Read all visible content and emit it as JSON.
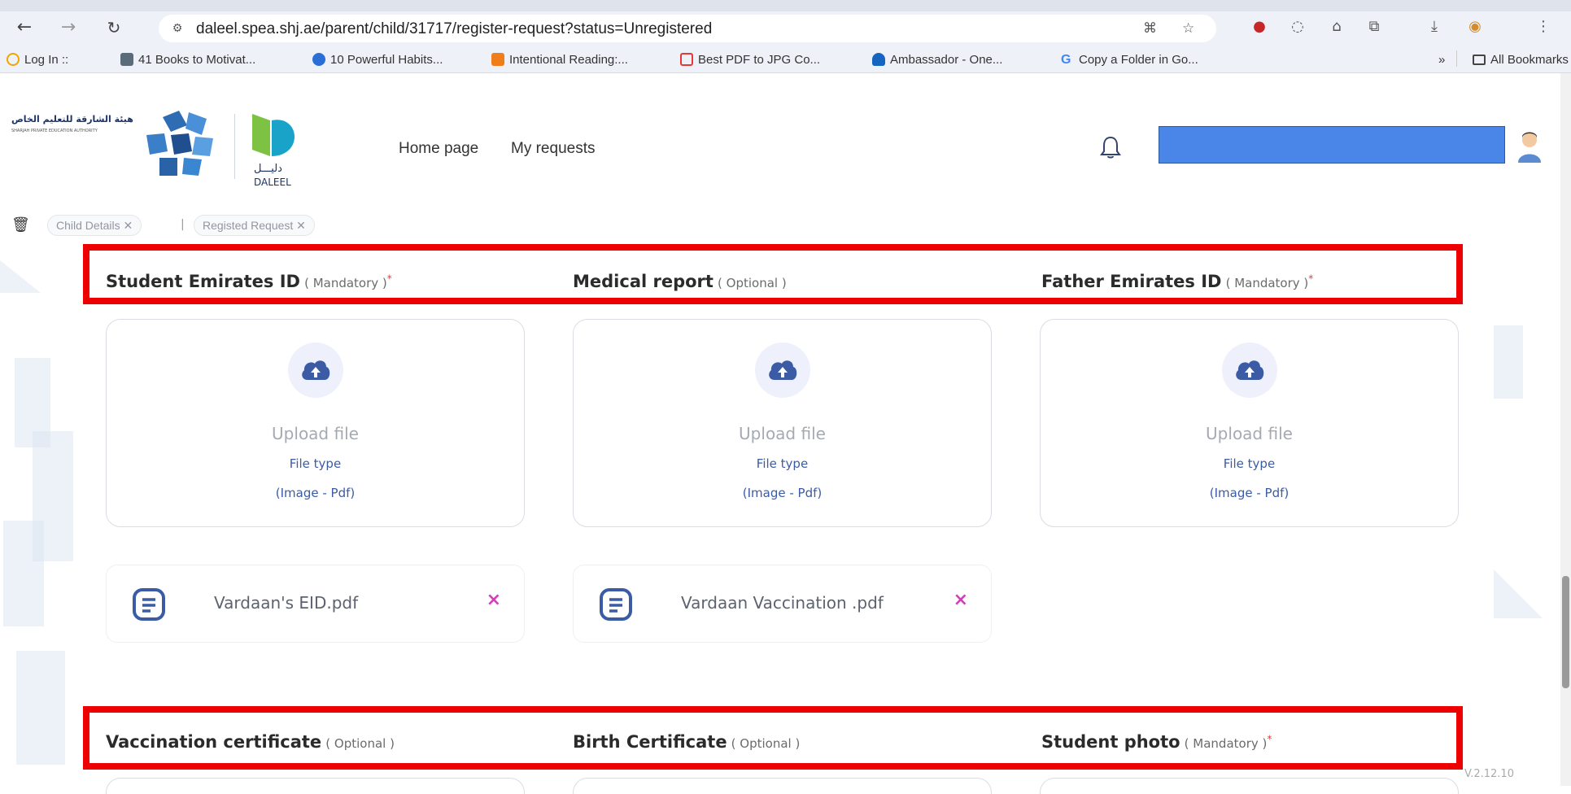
{
  "browser": {
    "url": "daleel.spea.shj.ae/parent/child/31717/register-request?status=Unregistered",
    "bookmarks": [
      {
        "label": "Log In ::"
      },
      {
        "label": "41 Books to Motivat..."
      },
      {
        "label": "10 Powerful Habits..."
      },
      {
        "label": "Intentional Reading:..."
      },
      {
        "label": "Best PDF to JPG Co..."
      },
      {
        "label": "Ambassador - One..."
      },
      {
        "label": "Copy a Folder in Go..."
      }
    ],
    "overflow_label": "»",
    "all_bookmarks_label": "All Bookmarks"
  },
  "header": {
    "logo_ar": "هيئة الشارقة للتعليم الخاص",
    "logo_en": "SHARJAH PRIVATE EDUCATION AUTHORITY",
    "daleel_label": "DALEEL",
    "nav": [
      {
        "label": "Home page"
      },
      {
        "label": "My requests"
      }
    ]
  },
  "breadcrumbs": [
    {
      "label": "Child Details ✕"
    },
    {
      "label": "Registed Request ✕"
    }
  ],
  "breadcrumb_separator": "|",
  "sections_row1": [
    {
      "title": "Student Emirates ID",
      "hint": "( Mandatory )",
      "required": "*"
    },
    {
      "title": "Medical report",
      "hint": "( Optional )",
      "required": ""
    },
    {
      "title": "Father Emirates ID",
      "hint": "( Mandatory )",
      "required": "*"
    }
  ],
  "upload_card": {
    "upload_label": "Upload file",
    "file_type_label": "File type",
    "file_type_values": "(Image -  Pdf)"
  },
  "uploaded_files": [
    {
      "name": "Vardaan's EID.pdf"
    },
    {
      "name": "Vardaan Vaccination .pdf"
    }
  ],
  "remove_glyph": "×",
  "sections_row2": [
    {
      "title": "Vaccination certificate",
      "hint": "( Optional )",
      "required": ""
    },
    {
      "title": "Birth Certificate",
      "hint": "( Optional )",
      "required": ""
    },
    {
      "title": "Student photo",
      "hint": "( Mandatory )",
      "required": "*"
    }
  ],
  "version": "V.2.12.10",
  "icons": [
    "back-icon",
    "forward-icon",
    "reload-icon",
    "site-info-icon",
    "translate-icon",
    "star-icon",
    "extension-icon",
    "download-icon",
    "profile-icon",
    "menu-icon",
    "bell-icon",
    "trash-icon",
    "cloud-upload-icon",
    "document-icon",
    "close-icon",
    "folder-icon"
  ],
  "colors": {
    "brand_blue": "#3b5ba5",
    "highlight_red": "#ee0000",
    "remove_magenta": "#d63cb8",
    "user_bar": "#4a86e8"
  }
}
